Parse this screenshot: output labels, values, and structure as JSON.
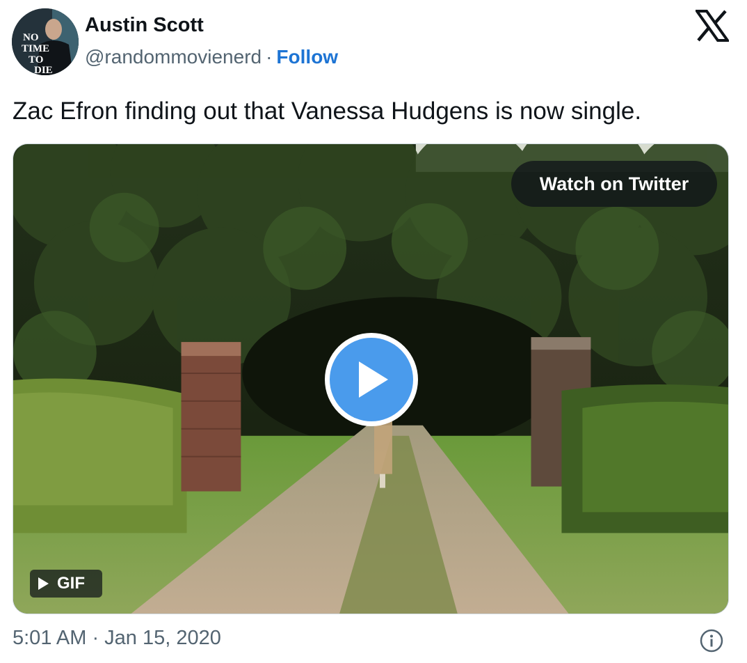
{
  "author": {
    "name": "Austin Scott",
    "handle": "@randommovienerd",
    "separator": "·",
    "follow_label": "Follow",
    "avatar_text": [
      "NO",
      "TIME",
      "TO",
      "DIE"
    ]
  },
  "tweet": {
    "text": "Zac Efron finding out that Vanessa Hudgens is now single."
  },
  "media": {
    "watch_label": "Watch on Twitter",
    "gif_label": "GIF",
    "play_icon": "play-icon"
  },
  "footer": {
    "timestamp": "5:01 AM · Jan 15, 2020",
    "info_icon": "info-icon"
  },
  "colors": {
    "follow": "#1d74d4",
    "play_button": "#4a9bec",
    "secondary_text": "#536471"
  }
}
